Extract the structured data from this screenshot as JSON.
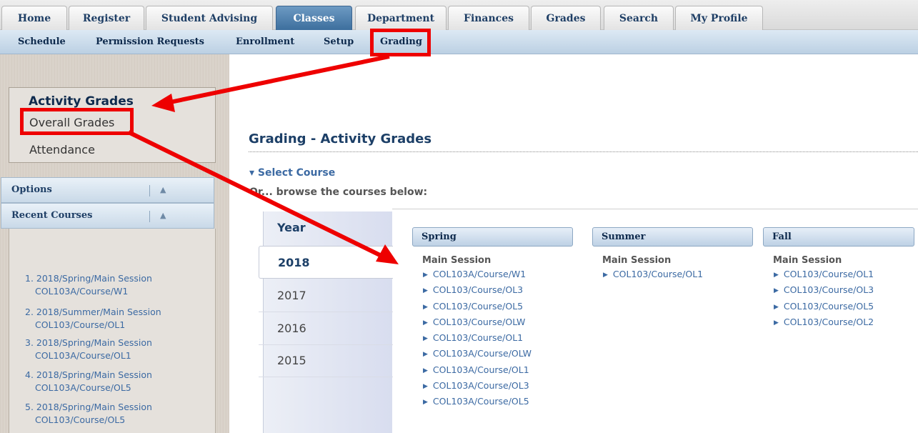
{
  "top_tabs": [
    "Home",
    "Register",
    "Student Advising",
    "Classes",
    "Department",
    "Finances",
    "Grades",
    "Search",
    "My Profile"
  ],
  "sub_nav": [
    "Schedule",
    "Permission Requests",
    "Enrollment",
    "Setup",
    "Grading"
  ],
  "grades_menu": [
    "Activity Grades",
    "Overall Grades",
    "Attendance"
  ],
  "panels": {
    "options": "Options",
    "recent": "Recent Courses",
    "toggle_icon": "▲"
  },
  "recent_courses": [
    {
      "line1": "1. 2018/Spring/Main Session",
      "line2": "COL103A/Course/W1"
    },
    {
      "line1": "2. 2018/Summer/Main Session",
      "line2": "COL103/Course/OL1"
    },
    {
      "line1": "3. 2018/Spring/Main Session",
      "line2": "COL103A/Course/OL1"
    },
    {
      "line1": "4. 2018/Spring/Main Session",
      "line2": "COL103A/Course/OL5"
    },
    {
      "line1": "5. 2018/Spring/Main Session",
      "line2": "COL103/Course/OL5"
    }
  ],
  "main": {
    "title": "Grading - Activity Grades",
    "select_course": "▾ Select Course",
    "browse_text": "Or... browse the courses below:",
    "year_header": "Year",
    "years": [
      "2018",
      "2017",
      "2016",
      "2015"
    ],
    "seasons": [
      {
        "name": "Spring",
        "session": "Main Session",
        "courses": [
          "COL103A/Course/W1",
          "COL103/Course/OL3",
          "COL103/Course/OL5",
          "COL103/Course/OLW",
          "COL103/Course/OL1",
          "COL103A/Course/OLW",
          "COL103A/Course/OL1",
          "COL103A/Course/OL3",
          "COL103A/Course/OL5"
        ]
      },
      {
        "name": "Summer",
        "session": "Main Session",
        "courses": [
          "COL103/Course/OL1"
        ]
      },
      {
        "name": "Fall",
        "session": "Main Session",
        "courses": [
          "COL103/Course/OL1",
          "COL103/Course/OL3",
          "COL103/Course/OL5",
          "COL103/Course/OL2"
        ]
      }
    ]
  },
  "colors": {
    "annotation": "#ee0000",
    "link": "#3c6aa3",
    "active_tab": "#3b6d9c"
  },
  "icons": {
    "bullet": "▶"
  }
}
